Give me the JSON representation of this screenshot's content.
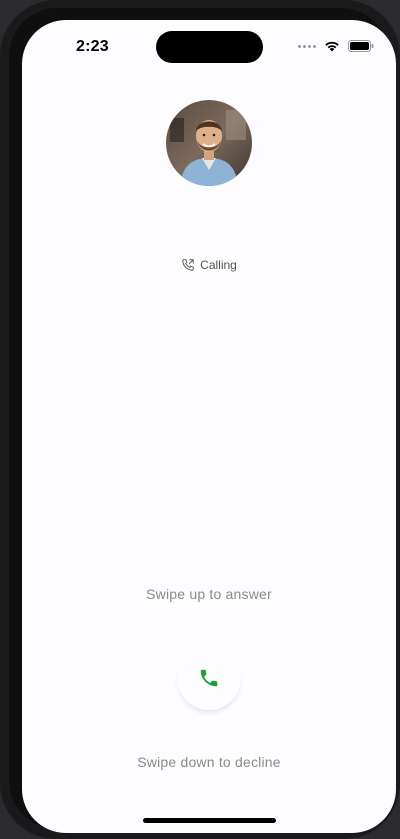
{
  "status_bar": {
    "time": "2:23"
  },
  "call": {
    "status_label": "Calling",
    "swipe_up_label": "Swipe up to answer",
    "swipe_down_label": "Swipe down to decline"
  },
  "colors": {
    "screen_bg": "#fdfcfe",
    "answer_green": "#1f9d3a",
    "hint_text": "#8a8a8a"
  },
  "icons": {
    "avatar": "caller-avatar",
    "status": "phone-outgoing-icon",
    "answer": "phone-icon"
  }
}
